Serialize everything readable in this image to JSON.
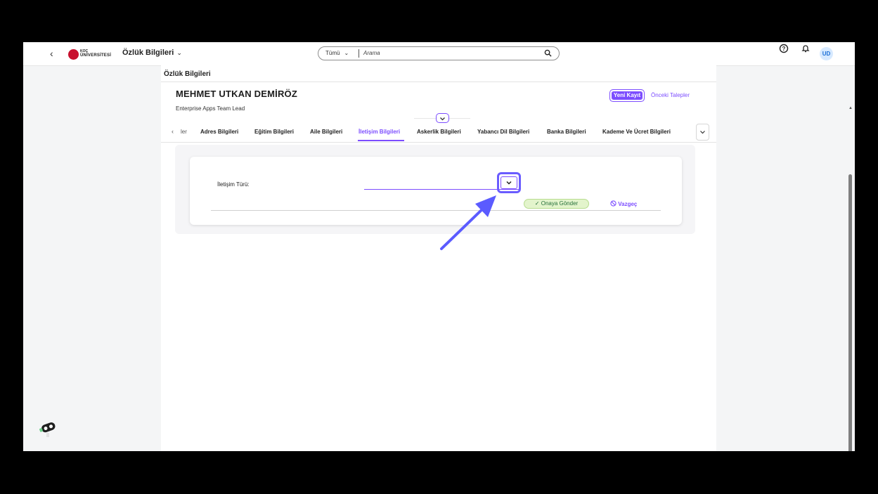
{
  "shellbar": {
    "logo": {
      "line1": "KOÇ",
      "line2": "ÜNİVERSİTESİ"
    },
    "app_title": "Özlük Bilgileri",
    "search": {
      "scope": "Tümü",
      "placeholder": "Arama"
    },
    "avatar_initials": "UD",
    "icons": [
      "back-icon",
      "chevron-down-icon",
      "search-icon",
      "help-icon",
      "bell-icon"
    ]
  },
  "page": {
    "title": "Özlük Bilgileri",
    "employee": {
      "name": "MEHMET UTKAN DEMİRÖZ",
      "role": "Enterprise Apps Team Lead"
    },
    "actions": {
      "new_record": "Yeni Kayıt",
      "previous_requests": "Önceki Talepler"
    },
    "tabs": [
      {
        "label": "ler",
        "active": false
      },
      {
        "label": "Adres Bilgileri",
        "active": false
      },
      {
        "label": "Eğitim Bilgileri",
        "active": false
      },
      {
        "label": "Aile Bilgileri",
        "active": false
      },
      {
        "label": "İletişim Bilgileri",
        "active": true
      },
      {
        "label": "Askerlik Bilgileri",
        "active": false
      },
      {
        "label": "Yabancı Dil Bilgileri",
        "active": false
      },
      {
        "label": "Banka Bilgileri",
        "active": false
      },
      {
        "label": "Kademe Ve Ücret Bilgileri",
        "active": false
      }
    ],
    "form": {
      "field_label": "İletişim Türü:",
      "select_value": "",
      "approve": "Onaya Gönder",
      "cancel": "Vazgeç"
    }
  },
  "colors": {
    "accent": "#7c4dff",
    "highlight": "#6a5cff",
    "approve_bg": "#e3f4cc",
    "approve_text": "#256f3a"
  }
}
